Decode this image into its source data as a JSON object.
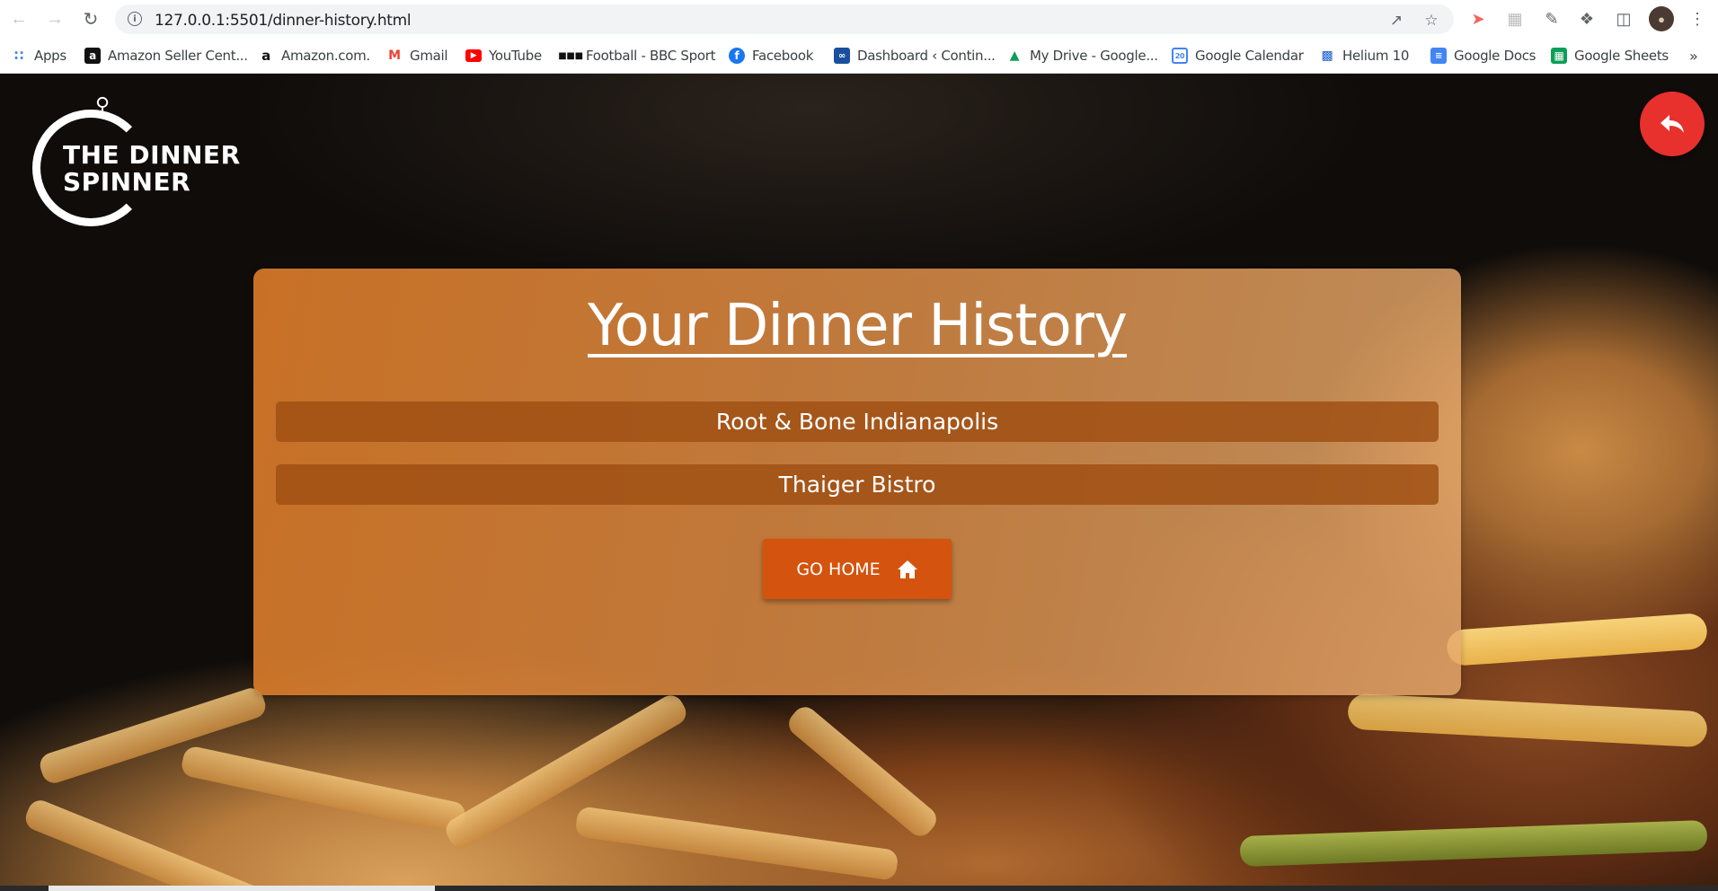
{
  "browser": {
    "url": "127.0.0.1:5501/dinner-history.html",
    "bookmarks": [
      {
        "label": "Apps",
        "icon": "apps-grid-icon"
      },
      {
        "label": "Amazon Seller Cent...",
        "icon": "amazon-icon"
      },
      {
        "label": "Amazon.com.",
        "icon": "amazon-a-icon"
      },
      {
        "label": "Gmail",
        "icon": "gmail-icon"
      },
      {
        "label": "YouTube",
        "icon": "youtube-icon"
      },
      {
        "label": "Football - BBC Sport",
        "icon": "bbc-icon"
      },
      {
        "label": "Facebook",
        "icon": "facebook-icon"
      },
      {
        "label": "Dashboard ‹ Contin...",
        "icon": "dashboard-icon"
      },
      {
        "label": "My Drive - Google...",
        "icon": "google-drive-icon"
      },
      {
        "label": "Google Calendar",
        "icon": "google-calendar-icon"
      },
      {
        "label": "Helium 10",
        "icon": "helium10-icon"
      },
      {
        "label": "Google Docs",
        "icon": "google-docs-icon"
      },
      {
        "label": "Google Sheets",
        "icon": "google-sheets-icon"
      }
    ],
    "overflow_label": "»"
  },
  "logo": {
    "text_line1": "THE DINNER",
    "text_line2": "SPINNER"
  },
  "panel": {
    "title": "Your Dinner History",
    "history": [
      "Root & Bone Indianapolis",
      "Thaiger Bistro"
    ],
    "home_button_label": "GO HOME"
  },
  "colors": {
    "accent": "#d4530e",
    "back_button": "#e8302d",
    "panel": "#d6782a"
  }
}
